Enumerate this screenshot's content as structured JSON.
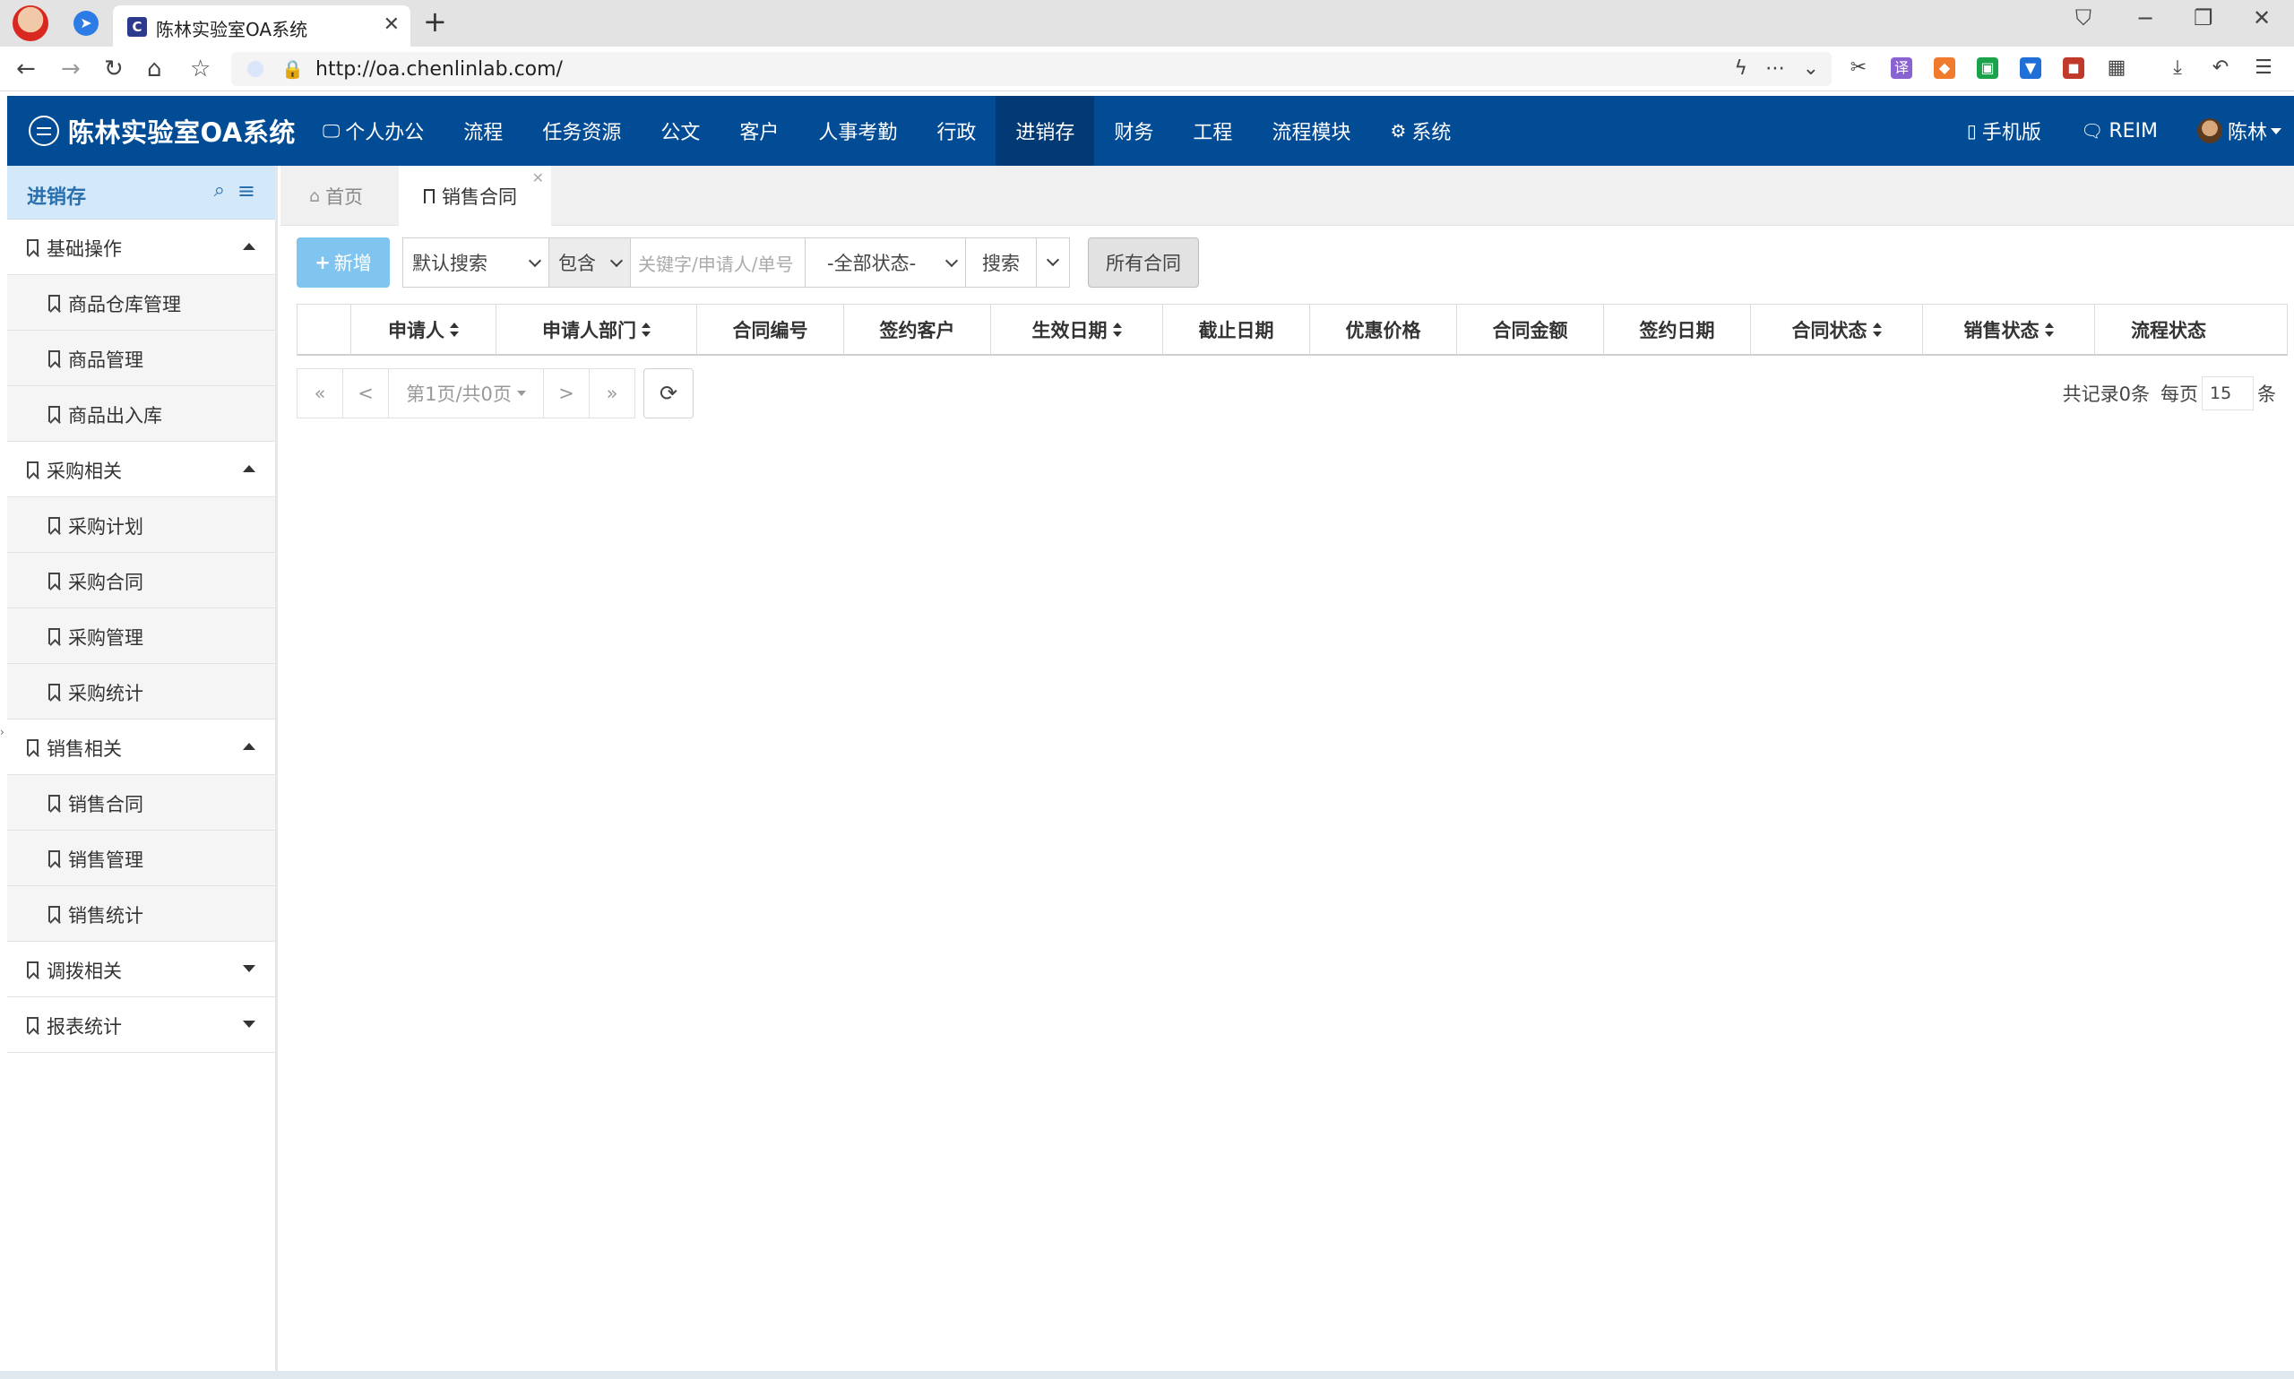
{
  "browser": {
    "tab_title": "陈林实验室OA系统",
    "url": "http://oa.chenlinlab.com/"
  },
  "header": {
    "logo_text": "陈林实验室OA系统",
    "nav": [
      "个人办公",
      "流程",
      "任务资源",
      "公文",
      "客户",
      "人事考勤",
      "行政",
      "进销存",
      "财务",
      "工程",
      "流程模块",
      "系统"
    ],
    "active_nav": "进销存",
    "mobile_label": "手机版",
    "reim_label": "REIM",
    "user_name": "陈林"
  },
  "sidebar": {
    "title": "进销存",
    "groups": [
      {
        "label": "基础操作",
        "expanded": true,
        "items": [
          "商品仓库管理",
          "商品管理",
          "商品出入库"
        ]
      },
      {
        "label": "采购相关",
        "expanded": true,
        "items": [
          "采购计划",
          "采购合同",
          "采购管理",
          "采购统计"
        ]
      },
      {
        "label": "销售相关",
        "expanded": true,
        "items": [
          "销售合同",
          "销售管理",
          "销售统计"
        ]
      },
      {
        "label": "调拨相关",
        "expanded": false,
        "items": []
      },
      {
        "label": "报表统计",
        "expanded": false,
        "items": []
      }
    ]
  },
  "content_tabs": {
    "home": "首页",
    "current": "销售合同"
  },
  "toolbar": {
    "add_label": "新增",
    "search_mode": "默认搜索",
    "match_mode": "包含",
    "keyword_placeholder": "关键字/申请人/单号",
    "status_filter": "-全部状态-",
    "search_label": "搜索",
    "all_label": "所有合同"
  },
  "table": {
    "columns": [
      {
        "label": "申请人",
        "sortable": true
      },
      {
        "label": "申请人部门",
        "sortable": true
      },
      {
        "label": "合同编号",
        "sortable": false
      },
      {
        "label": "签约客户",
        "sortable": false
      },
      {
        "label": "生效日期",
        "sortable": true
      },
      {
        "label": "截止日期",
        "sortable": false
      },
      {
        "label": "优惠价格",
        "sortable": false
      },
      {
        "label": "合同金额",
        "sortable": false
      },
      {
        "label": "签约日期",
        "sortable": false
      },
      {
        "label": "合同状态",
        "sortable": true
      },
      {
        "label": "销售状态",
        "sortable": true
      },
      {
        "label": "流程状态",
        "sortable": false
      }
    ],
    "rows": []
  },
  "pager": {
    "first": "«",
    "prev": "<",
    "page_text": "第1页/共0页",
    "next": ">",
    "last": "»",
    "total_text": "共记录0条",
    "per_page_label": "每页",
    "page_size": "15",
    "unit": "条"
  }
}
